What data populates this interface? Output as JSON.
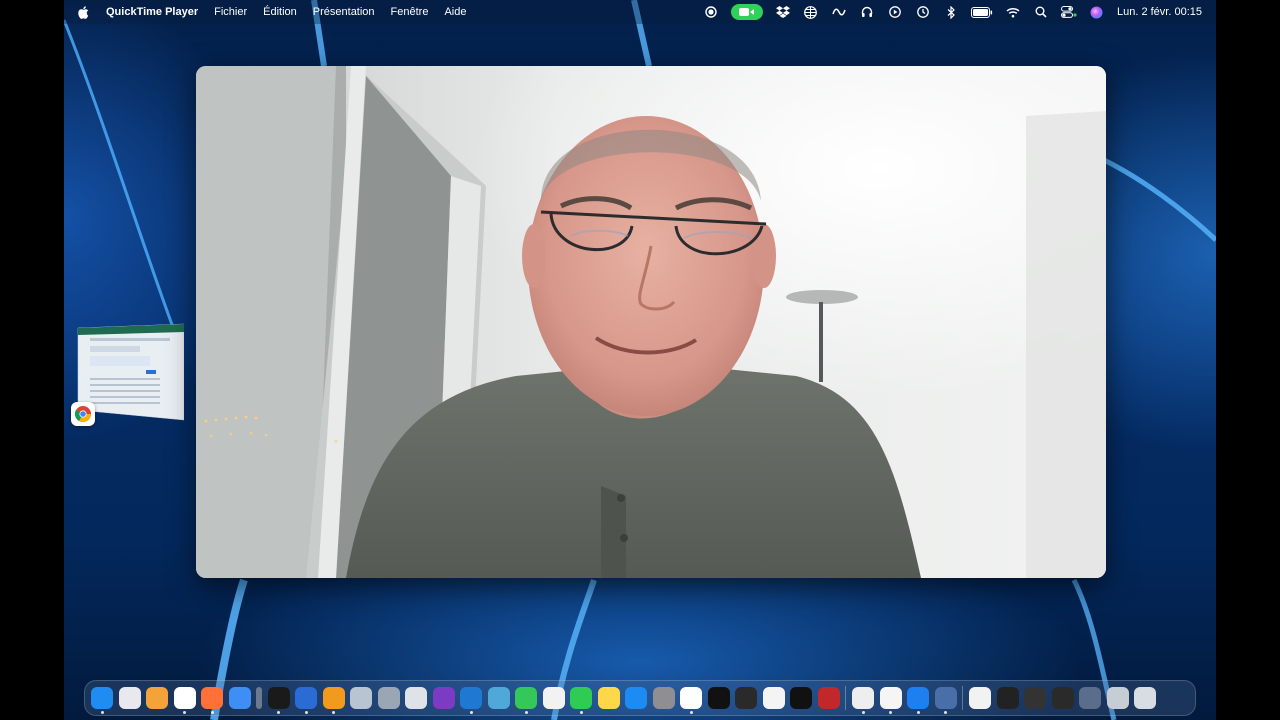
{
  "menubar": {
    "apple_icon": "apple-logo-icon",
    "app_name": "QuickTime Player",
    "menus": [
      "Fichier",
      "Édition",
      "Présentation",
      "Fenêtre",
      "Aide"
    ],
    "status_icons": [
      "record-icon",
      "facetime-icon",
      "dropbox-icon",
      "globe-icon",
      "wave-icon",
      "headphones-icon",
      "play-circle-icon",
      "time-machine-icon",
      "bluetooth-icon",
      "battery-icon",
      "wifi-icon",
      "search-icon",
      "control-center-icon",
      "siri-icon"
    ],
    "clock": "Lun. 2 févr.  00:15"
  },
  "video": {
    "description_icon": "webcam-video-frame"
  },
  "stage_manager": {
    "app_icon": "chrome-icon"
  },
  "dock": {
    "apps": [
      {
        "name": "finder",
        "color": "#1e8cf0"
      },
      {
        "name": "launchpad",
        "color": "#e8e8ee"
      },
      {
        "name": "home",
        "color": "#f3a33a"
      },
      {
        "name": "chrome",
        "color": "#ffffff"
      },
      {
        "name": "firefox",
        "color": "#ff7139"
      },
      {
        "name": "safari",
        "color": "#3d8ff5"
      },
      {
        "name": "notes-strip",
        "color": "#6b7a8f"
      },
      {
        "name": "terminal",
        "color": "#1a1a1a"
      },
      {
        "name": "xcode",
        "color": "#2b6bd6"
      },
      {
        "name": "sublime",
        "color": "#f29a1d"
      },
      {
        "name": "cloud",
        "color": "#b9c4d2"
      },
      {
        "name": "system-utility",
        "color": "#9aa6b4"
      },
      {
        "name": "disk-utility",
        "color": "#dfe3e8"
      },
      {
        "name": "github-desktop",
        "color": "#7b3cc3"
      },
      {
        "name": "vscode",
        "color": "#1f79d2"
      },
      {
        "name": "teams",
        "color": "#4fa8d8"
      },
      {
        "name": "messages",
        "color": "#34c759"
      },
      {
        "name": "photos",
        "color": "#f2f2f2"
      },
      {
        "name": "facetime",
        "color": "#2fcb55"
      },
      {
        "name": "notes",
        "color": "#ffd84a"
      },
      {
        "name": "app-store",
        "color": "#1d8cf2"
      },
      {
        "name": "system-settings",
        "color": "#8e8e93"
      },
      {
        "name": "slack",
        "color": "#ffffff"
      },
      {
        "name": "apple-tv",
        "color": "#111111"
      },
      {
        "name": "calculator",
        "color": "#2a2a2a"
      },
      {
        "name": "chatgpt",
        "color": "#f4f4f4"
      },
      {
        "name": "tradingview",
        "color": "#111111"
      },
      {
        "name": "photo-booth",
        "color": "#c1282a"
      },
      {
        "name": "sep1",
        "color": "sep"
      },
      {
        "name": "podcast",
        "color": "#eeeeee"
      },
      {
        "name": "textedit",
        "color": "#f5f5f5"
      },
      {
        "name": "quicktime",
        "color": "#1e7ff0"
      },
      {
        "name": "screenshot",
        "color": "#4a6fa8"
      },
      {
        "name": "sep2",
        "color": "sep"
      },
      {
        "name": "document-1",
        "color": "#f2f2f2"
      },
      {
        "name": "window-1",
        "color": "#222222"
      },
      {
        "name": "window-2",
        "color": "#333333"
      },
      {
        "name": "window-3",
        "color": "#2a2a2a"
      },
      {
        "name": "window-4",
        "color": "#5a6e8c"
      },
      {
        "name": "window-5",
        "color": "#c7cdd5"
      },
      {
        "name": "trash",
        "color": "#d8dde3"
      }
    ]
  }
}
